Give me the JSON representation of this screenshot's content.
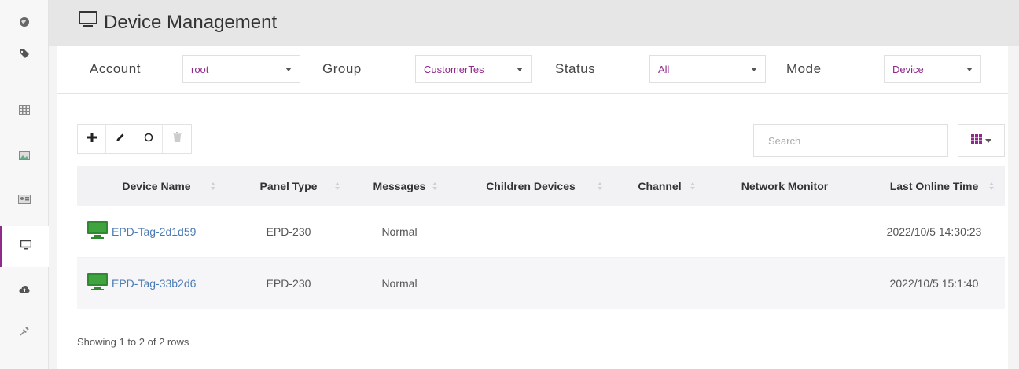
{
  "sidebar": {
    "items": [
      {
        "icon": "globe-icon"
      },
      {
        "icon": "tag-icon"
      },
      {
        "icon": "grid-icon"
      },
      {
        "icon": "image-icon"
      },
      {
        "icon": "id-card-icon"
      },
      {
        "icon": "monitor-icon"
      },
      {
        "icon": "cloud-upload-icon"
      },
      {
        "icon": "pin-icon"
      }
    ],
    "active_color": "#8e2a8a"
  },
  "header": {
    "title": "Device Management"
  },
  "filters": {
    "account_label": "Account",
    "account_value": "root",
    "group_label": "Group",
    "group_value": "CustomerTes",
    "status_label": "Status",
    "status_value": "All",
    "mode_label": "Mode",
    "mode_value": "Device"
  },
  "toolbar": {
    "add_icon": "plus-icon",
    "edit_icon": "pencil-icon",
    "refresh_icon": "circle-icon",
    "delete_icon": "trash-icon"
  },
  "search": {
    "placeholder": "Search"
  },
  "table": {
    "headers": [
      "Device Name",
      "Panel Type",
      "Messages",
      "Children Devices",
      "Channel",
      "Network Monitor",
      "Last Online Time"
    ],
    "rows": [
      {
        "name": "EPD-Tag-2d1d59",
        "panel_type": "EPD-230",
        "messages": "Normal",
        "children": "",
        "channel": "",
        "network": "",
        "last_online": "2022/10/5 14:30:23"
      },
      {
        "name": "EPD-Tag-33b2d6",
        "panel_type": "EPD-230",
        "messages": "Normal",
        "children": "",
        "channel": "",
        "network": "",
        "last_online": "2022/10/5 15:1:40"
      }
    ]
  },
  "footer": {
    "text": "Showing 1 to 2 of 2 rows"
  },
  "colors": {
    "accent": "#8e2a8a",
    "link": "#4a7ab5",
    "device_icon": "#2f8a2f"
  }
}
